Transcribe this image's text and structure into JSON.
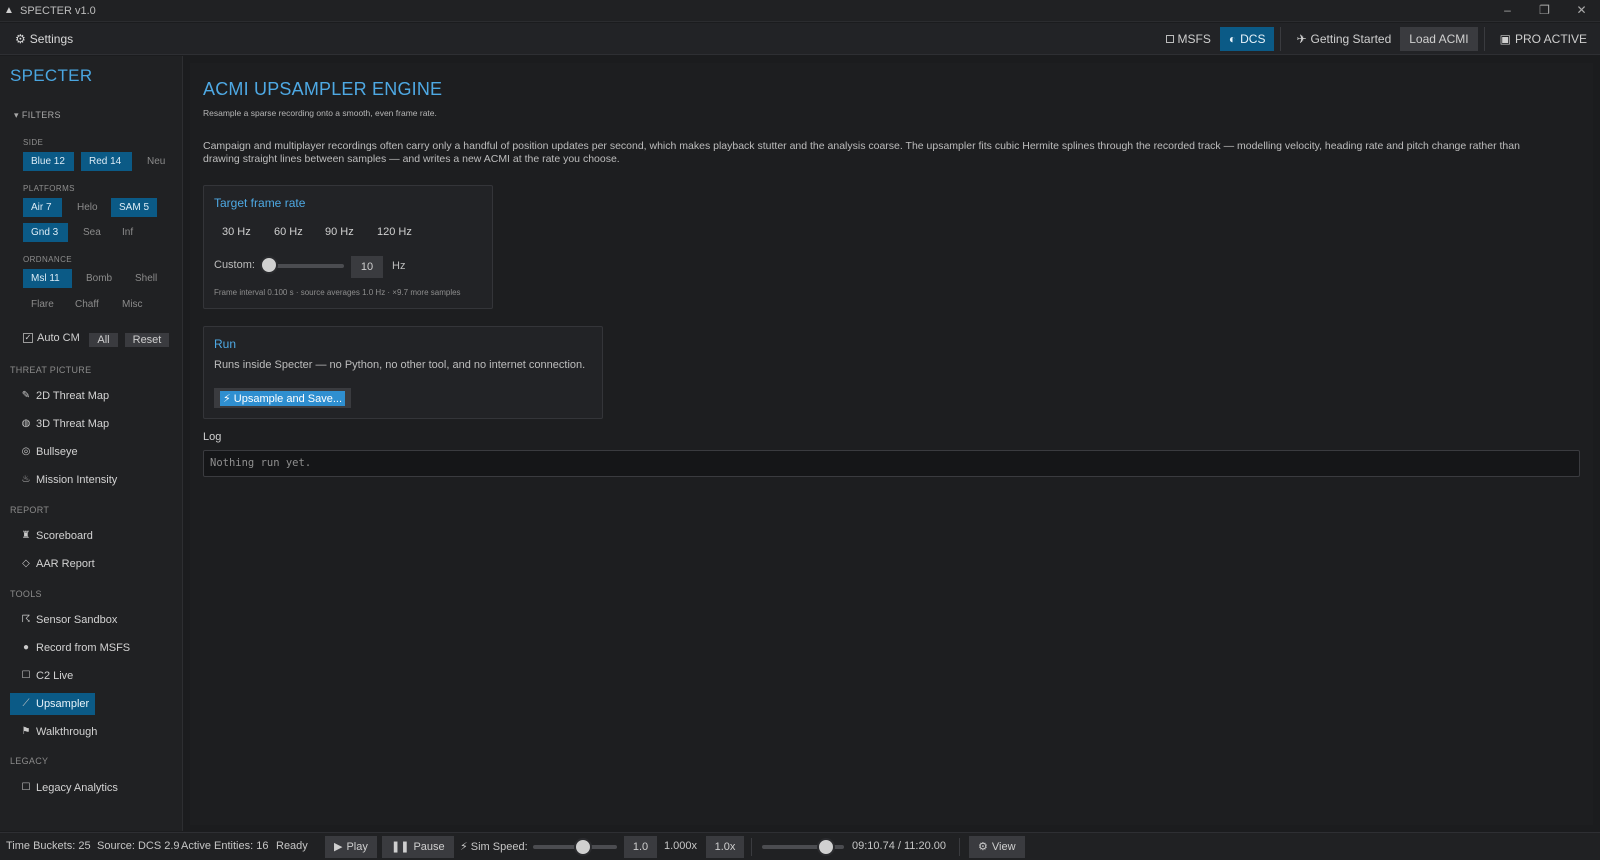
{
  "window": {
    "title": "SPECTER v1.0",
    "controls": {
      "minimize": "–",
      "restore": "❐",
      "close": "✕"
    }
  },
  "menubar": {
    "settings_label": "Settings",
    "msfs_label": "MSFS",
    "dcs_label": "DCS",
    "getting_started_label": "Getting Started",
    "load_acmi_label": "Load ACMI",
    "pro_label": "PRO ACTIVE"
  },
  "sidebar": {
    "brand": "SPECTER",
    "filters_label": "▾ FILTERS",
    "side_label": "SIDE",
    "side_chips": [
      "Blue 12",
      "Red 14",
      "Neu"
    ],
    "platforms_label": "PLATFORMS",
    "platform_chips": [
      "Air 7",
      "Helo",
      "SAM 5",
      "Gnd 3",
      "Sea",
      "Inf"
    ],
    "ordnance_label": "ORDNANCE",
    "ordnance_chips": [
      "Msl 11",
      "Bomb",
      "Shell",
      "Flare",
      "Chaff",
      "Misc"
    ],
    "auto_cm_label": "Auto CM",
    "all_label": "All",
    "reset_label": "Reset",
    "sections": {
      "threat": "THREAT PICTURE",
      "report": "REPORT",
      "tools": "TOOLS",
      "legacy": "LEGACY"
    },
    "items": {
      "threat_2d": "2D Threat Map",
      "threat_3d": "3D Threat Map",
      "bullseye": "Bullseye",
      "mission_intensity": "Mission Intensity",
      "scoreboard": "Scoreboard",
      "aar_report": "AAR Report",
      "sensor_sandbox": "Sensor Sandbox",
      "record_msfs": "Record from MSFS",
      "c2_live": "C2 Live",
      "upsampler": "Upsampler",
      "walkthrough": "Walkthrough",
      "legacy_analytics": "Legacy Analytics"
    },
    "active_item": "upsampler"
  },
  "main": {
    "title": "ACMI UPSAMPLER ENGINE",
    "subtitle": "Resample a sparse recording onto a smooth, even frame rate.",
    "description": "Campaign and multiplayer recordings often carry only a handful of position updates per second, which makes playback stutter and the analysis coarse. The upsampler fits cubic Hermite splines through the recorded track — modelling velocity, heading rate and pitch change rather than drawing straight lines between samples — and writes a new ACMI at the rate you choose.",
    "frame_rate_panel": {
      "title": "Target frame rate",
      "rates": [
        "30 Hz",
        "60 Hz",
        "90 Hz",
        "120 Hz"
      ],
      "custom_label": "Custom:",
      "custom_value": "10",
      "slider_fraction": 0.04,
      "unit": "Hz",
      "footer": "Frame interval 0.100 s  ·  source averages 1.0 Hz  ·  ×9.7 more samples"
    },
    "run_panel": {
      "title": "Run",
      "description": "Runs inside Specter — no Python, no other tool, and no internet connection.",
      "button_label": "⚡ Upsample and Save..."
    },
    "log": {
      "label": "Log",
      "text": "Nothing run yet."
    }
  },
  "statusbar": {
    "time_buckets": "Time Buckets: 25",
    "source": "Source: DCS 2.9",
    "active_entities": "Active Entities: 16",
    "ready": "Ready",
    "play_label": "Play",
    "pause_label": "Pause",
    "sim_speed_label": "⚡ Sim Speed:",
    "sim_speed_fraction": 0.6,
    "sim_speed_value": "1.0",
    "speed_multiplier": "1.000x",
    "speed_button": "1.0x",
    "time_fraction": 0.78,
    "time_readout": "09:10.74 / 11:20.00",
    "view_label": "View"
  },
  "colors": {
    "accent": "#4ea9e4",
    "active_bg": "#0b5a86",
    "button_primary": "#2f8fd0"
  }
}
